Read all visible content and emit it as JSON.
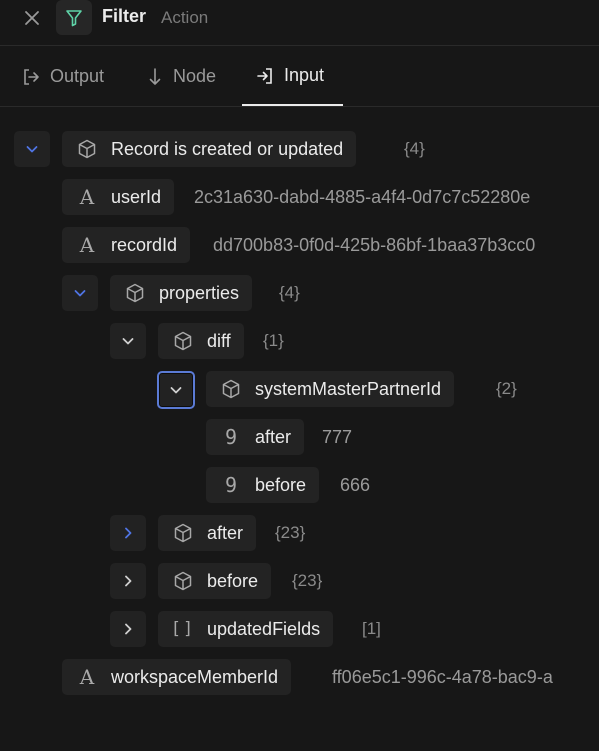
{
  "header": {
    "title": "Filter",
    "subtitle": "Action",
    "close_icon": "close-icon",
    "filter_icon": "filter-icon"
  },
  "tabs": [
    {
      "label": "Output",
      "icon": "output-icon",
      "active": false
    },
    {
      "label": "Node",
      "icon": "arrow-down-icon",
      "active": false
    },
    {
      "label": "Input",
      "icon": "input-icon",
      "active": true
    }
  ],
  "tree": {
    "root": {
      "label": "Record is created or updated",
      "count": "{4}",
      "expanded": true
    },
    "userId": {
      "label": "userId",
      "value": "2c31a630-dabd-4885-a4f4-0d7c7c52280e"
    },
    "recordId": {
      "label": "recordId",
      "value": "dd700b83-0f0d-425b-86bf-1baa37b3cc0"
    },
    "properties": {
      "label": "properties",
      "count": "{4}",
      "expanded": true
    },
    "diff": {
      "label": "diff",
      "count": "{1}",
      "expanded": true
    },
    "systemMasterPartnerId": {
      "label": "systemMasterPartnerId",
      "count": "{2}",
      "expanded": true
    },
    "diff_after": {
      "label": "after",
      "value": "777"
    },
    "diff_before": {
      "label": "before",
      "value": "666"
    },
    "after": {
      "label": "after",
      "count": "{23}",
      "expanded": false
    },
    "before": {
      "label": "before",
      "count": "{23}",
      "expanded": false
    },
    "updatedFields": {
      "label": "updatedFields",
      "count": "[1]",
      "expanded": false
    },
    "workspaceMemberId": {
      "label": "workspaceMemberId",
      "value": "ff06e5c1-996c-4a78-bac9-a"
    }
  },
  "colors": {
    "background": "#171717",
    "chip": "#232323",
    "accent_focus": "#5b7bd5",
    "chevron_blue": "#4f74e3"
  }
}
